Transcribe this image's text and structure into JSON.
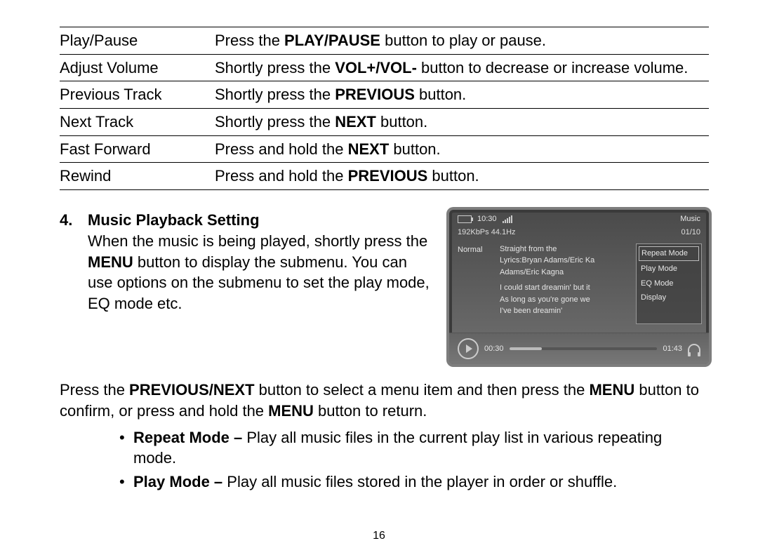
{
  "table": [
    {
      "action": "Play/Pause",
      "desc_parts": [
        "Press the ",
        "PLAY/PAUSE",
        " button to play or pause."
      ]
    },
    {
      "action": "Adjust Volume",
      "desc_parts": [
        "Shortly press the ",
        "VOL+/VOL-",
        " button to decrease or increase volume."
      ]
    },
    {
      "action": "Previous Track",
      "desc_parts": [
        "Shortly press the ",
        "PREVIOUS",
        " button."
      ]
    },
    {
      "action": "Next Track",
      "desc_parts": [
        "Shortly press the ",
        "NEXT",
        " button."
      ]
    },
    {
      "action": "Fast Forward",
      "desc_parts": [
        "Press and hold the ",
        "NEXT",
        " button."
      ]
    },
    {
      "action": "Rewind",
      "desc_parts": [
        "Press and hold the ",
        "PREVIOUS",
        " button."
      ]
    }
  ],
  "section": {
    "number": "4.",
    "title": "Music Playback Setting",
    "body_parts": [
      "When the music is being played, shortly press the ",
      "MENU",
      " button to display the submenu. You can use options on the submenu to set the play mode, EQ mode etc."
    ]
  },
  "para2_parts": [
    "Press the ",
    "PREVIOUS/NEXT",
    " button to select a menu item and then press the ",
    "MENU",
    " button to confirm, or press and hold the ",
    "MENU",
    " button to return."
  ],
  "bullets": [
    {
      "lead": "Repeat Mode – ",
      "rest": "Play all music files in the current play list in various repeating mode."
    },
    {
      "lead": "Play Mode – ",
      "rest": "Play all music files stored in the player in order or shuffle."
    }
  ],
  "page_number": "16",
  "player": {
    "time": "10:30",
    "title": "Music",
    "bitrate": "192KbPs 44.1Hz",
    "track_index": "01/10",
    "eq_label": "Normal",
    "song_title": "Straight from the",
    "lyrics1": "Lyrics:Bryan Adams/Eric Ka",
    "lyrics2": "Adams/Eric Kagna",
    "lyrics3": "I could start dreamin' but it",
    "lyrics4": "As long as you're gone we",
    "lyrics5": "I've been dreamin'",
    "menu": [
      "Repeat Mode",
      "Play Mode",
      "EQ Mode",
      "Display"
    ],
    "elapsed": "00:30",
    "total": "01:43"
  }
}
